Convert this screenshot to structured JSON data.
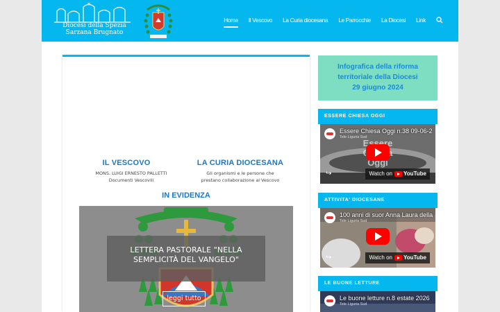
{
  "header": {
    "logo_text_line1": "Diocesi della Spezia",
    "logo_text_line2": "Sarzana  Brugnato"
  },
  "nav": {
    "items": [
      "Home",
      "Il Vescovo",
      "La Curia diocesana",
      "Le Parrocchie",
      "La Diocesi",
      "Link"
    ],
    "active": "Home",
    "search_icon": "search-icon"
  },
  "main": {
    "vescovo": {
      "title": "IL VESCOVO",
      "line1": "MONS. LUIGI ERNESTO PALLETTI",
      "line2": "Documenti Vescovili"
    },
    "curia": {
      "title": "LA CURIA DIOCESANA",
      "line1": "Gli organismi e le persone che",
      "line2": "prestano collaborazione al Vescovo"
    },
    "evidenza_title": "IN EVIDENZA",
    "hero": {
      "title_line1": "LETTERA PASTORALE \"NELLA",
      "title_line2": "SEMPLICITÀ DEL VANGELO\"",
      "button": "leggi tutto"
    }
  },
  "sidebar": {
    "info": {
      "line1": "Infografica della riforma",
      "line2": "territoriale della Diocesi",
      "line3": "29 giugno 2024"
    },
    "widgets": [
      {
        "heading": "ESSERE CHIESA OGGI",
        "video_title": "Essere Chiesa Oggi n.38 09-06-2",
        "channel": "Tele Liguria Sud",
        "watch_on": "Watch on",
        "brand": "YouTube"
      },
      {
        "heading": "ATTIVITA' DIOCESANE",
        "video_title": "100 anni di suor Anna Laura della",
        "channel": "Tele Liguria Sud",
        "watch_on": "Watch on",
        "brand": "YouTube"
      },
      {
        "heading": "LE BUONE LETTURE",
        "video_title": "Le buone letture n.8 estate 2026",
        "channel": "Tele Liguria Sud"
      }
    ]
  },
  "colors": {
    "header_bg": "#05b7ef",
    "heading_blue": "#1a78c2",
    "info_bg": "#7ddec1",
    "youtube_red": "#ff0000"
  }
}
